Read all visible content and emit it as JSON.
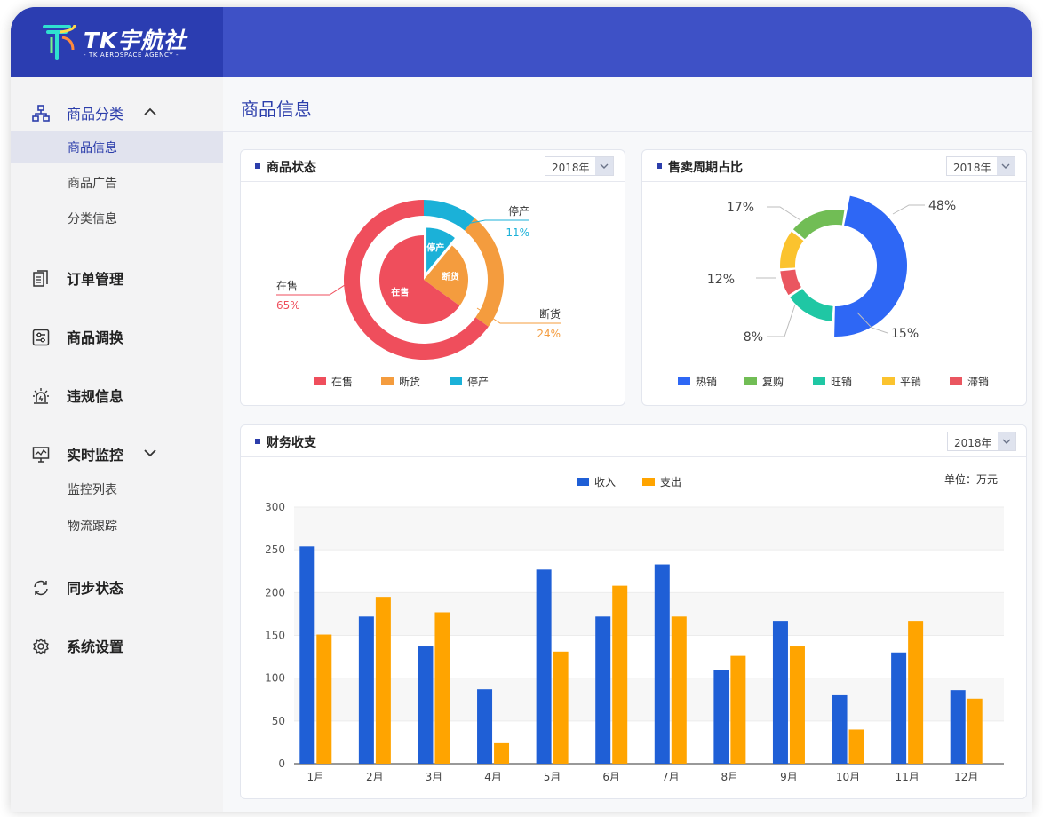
{
  "brand": {
    "name": "TK宇航社",
    "tagline": "- TK AEROSPACE AGENCY -"
  },
  "colors": {
    "header": "#3e51c6",
    "accent": "#2c3eab",
    "income": "#1f5fd6",
    "expense": "#ffa400"
  },
  "sidebar": {
    "groups": [
      {
        "label": "商品分类",
        "icon": "sitemap-icon",
        "expanded": true,
        "children": [
          {
            "label": "商品信息",
            "active": true
          },
          {
            "label": "商品广告"
          },
          {
            "label": "分类信息"
          }
        ]
      },
      {
        "label": "订单管理",
        "icon": "documents-icon"
      },
      {
        "label": "商品调换",
        "icon": "sliders-icon"
      },
      {
        "label": "违规信息",
        "icon": "alarm-icon"
      },
      {
        "label": "实时监控",
        "icon": "monitor-icon",
        "expanded": true,
        "children": [
          {
            "label": "监控列表"
          },
          {
            "label": "物流跟踪"
          }
        ]
      },
      {
        "label": "同步状态",
        "icon": "sync-icon"
      },
      {
        "label": "系统设置",
        "icon": "gear-icon"
      }
    ]
  },
  "page": {
    "title": "商品信息"
  },
  "cards": {
    "status": {
      "title": "商品状态",
      "year": "2018年"
    },
    "cycle": {
      "title": "售卖周期占比",
      "year": "2018年"
    },
    "finance": {
      "title": "财务收支",
      "year": "2018年",
      "unit": "单位：万元"
    }
  },
  "chart_data": [
    {
      "type": "pie",
      "title": "商品状态",
      "labels": [
        "在售",
        "断货",
        "停产"
      ],
      "values": [
        65,
        24,
        11
      ],
      "value_labels": [
        "65%",
        "24%",
        "11%"
      ],
      "colors": [
        "#ef4e5c",
        "#f49c3e",
        "#1bb1d8"
      ],
      "legend": "bottom"
    },
    {
      "type": "pie",
      "title": "售卖周期占比",
      "labels": [
        "热销",
        "复购",
        "旺销",
        "平销",
        "滞销"
      ],
      "values": [
        48,
        17,
        15,
        12,
        8
      ],
      "slice_order": [
        "热销",
        "旺销",
        "滞销",
        "平销",
        "复购"
      ],
      "value_labels": {
        "热销": "48%",
        "复购": "17%",
        "旺销": "15%",
        "平销": "12%",
        "滞销": "8%"
      },
      "colors": {
        "热销": "#2e67f5",
        "复购": "#71bd55",
        "旺销": "#1fc7a4",
        "平销": "#fbc32e",
        "滞销": "#ea5660"
      },
      "legend": "bottom"
    },
    {
      "type": "bar",
      "title": "财务收支",
      "categories": [
        "1月",
        "2月",
        "3月",
        "4月",
        "5月",
        "6月",
        "7月",
        "8月",
        "9月",
        "10月",
        "11月",
        "12月"
      ],
      "series": [
        {
          "name": "收入",
          "values": [
            254,
            172,
            137,
            87,
            227,
            172,
            233,
            109,
            167,
            80,
            130,
            86
          ]
        },
        {
          "name": "支出",
          "values": [
            151,
            195,
            177,
            24,
            131,
            208,
            172,
            126,
            137,
            40,
            167,
            76
          ]
        }
      ],
      "ylim": [
        0,
        300
      ],
      "yticks": [
        0,
        50,
        100,
        150,
        200,
        250,
        300
      ],
      "grid": true,
      "legend": "top-center"
    }
  ]
}
